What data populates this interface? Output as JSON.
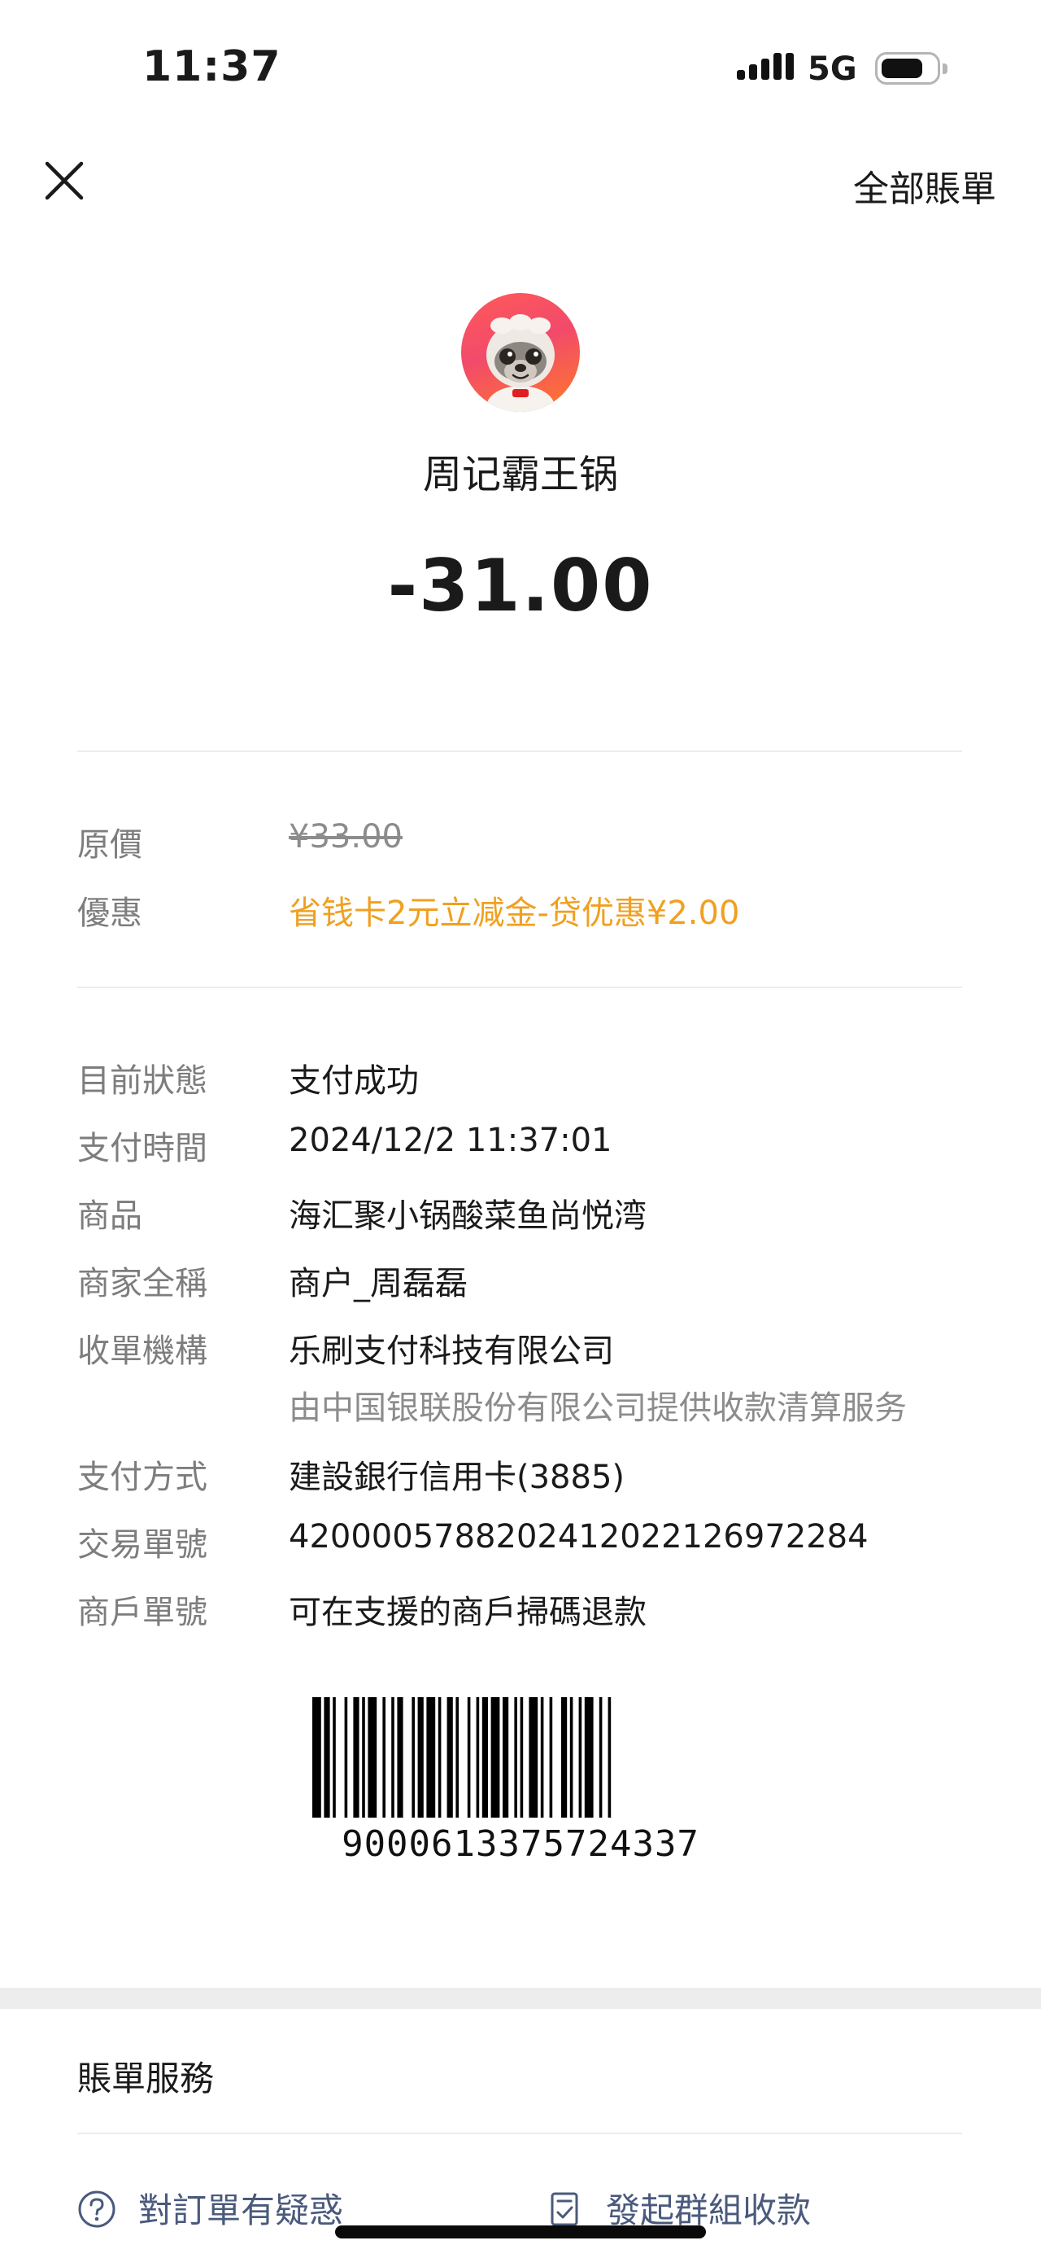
{
  "status_bar": {
    "time": "11:37",
    "network": "5G"
  },
  "header": {
    "close_icon": "close-icon",
    "all_bills": "全部賬單"
  },
  "merchant": {
    "name": "周记霸王锅",
    "amount": "-31.00"
  },
  "pricing": {
    "original_label": "原價",
    "original_value": "¥33.00",
    "discount_label": "優惠",
    "discount_value": "省钱卡2元立减金-贷优惠¥2.00"
  },
  "details": [
    {
      "label": "目前狀態",
      "value": "支付成功"
    },
    {
      "label": "支付時間",
      "value": "2024/12/2 11:37:01"
    },
    {
      "label": "商品",
      "value": "海汇聚小锅酸菜鱼尚悦湾"
    },
    {
      "label": "商家全稱",
      "value": "商户_周磊磊"
    },
    {
      "label": "收單機構",
      "value": "乐刷支付科技有限公司",
      "sub": "由中国银联股份有限公司提供收款清算服务"
    },
    {
      "label": "支付方式",
      "value": "建設銀行信用卡(3885)"
    },
    {
      "label": "交易單號",
      "value": "4200005788202412022126972284"
    },
    {
      "label": "商戶單號",
      "value": "可在支援的商戶掃碼退款"
    }
  ],
  "barcode": {
    "number": "9000613375724337"
  },
  "services": {
    "title": "賬單服務",
    "items": [
      {
        "label": "對訂單有疑惑",
        "icon": "question-circle-icon"
      },
      {
        "label": "發起群組收款",
        "icon": "checklist-icon"
      }
    ]
  },
  "colors": {
    "discount": "#f0a020",
    "link": "#4a5a7c",
    "label": "#7d7d7d"
  }
}
